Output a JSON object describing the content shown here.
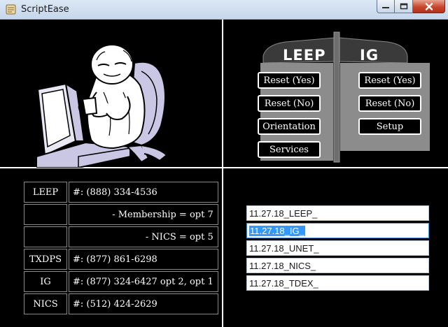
{
  "window": {
    "title": "ScriptEase"
  },
  "panel": {
    "leep_header": "LEEP",
    "ig_header": "IG",
    "leep_buttons": [
      "Reset (Yes)",
      "Reset (No)",
      "Orientation",
      "Services"
    ],
    "ig_buttons": [
      "Reset (Yes)",
      "Reset (No)",
      "Setup"
    ]
  },
  "phone_table": {
    "rows": [
      {
        "label": "LEEP",
        "value": "#: (888) 334-4536"
      },
      {
        "label": "",
        "value": "- Membership = opt 7"
      },
      {
        "label": "",
        "value": "- NICS = opt 5"
      },
      {
        "label": "TXDPS",
        "value": "#: (877) 861-6298"
      },
      {
        "label": "IG",
        "value": "#: (877) 324-6427 opt 2, opt 1"
      },
      {
        "label": "NICS",
        "value": "#: (512) 424-2629"
      }
    ]
  },
  "file_list": {
    "items": [
      "11.27.18_LEEP_",
      "11.27.18_IG_",
      "11.27.18_UNET_",
      "11.27.18_NICS_",
      "11.27.18_TDEX_"
    ],
    "selected_index": 1
  },
  "icons": {
    "app": "scroll-icon",
    "minimize": "minimize-icon",
    "maximize": "maximize-icon",
    "close": "close-icon"
  },
  "colors": {
    "background": "#000000",
    "panel_gray": "#8c8c8c",
    "selection": "#3399ff",
    "close_button": "#c7462d"
  }
}
